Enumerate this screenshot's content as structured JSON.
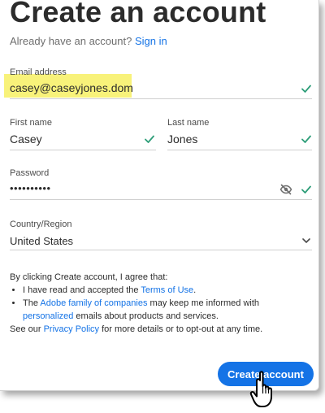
{
  "page": {
    "title": "Create an account",
    "signin_prompt": "Already have an account?",
    "signin_link": "Sign in"
  },
  "form": {
    "email": {
      "label": "Email address",
      "value": "casey@caseyjones.dom"
    },
    "first_name": {
      "label": "First name",
      "value": "Casey"
    },
    "last_name": {
      "label": "Last name",
      "value": "Jones"
    },
    "password": {
      "label": "Password",
      "value": "••••••••••"
    },
    "country": {
      "label": "Country/Region",
      "value": "United States"
    }
  },
  "terms": {
    "intro": "By clicking Create account, I agree that:",
    "bullet1_pre": "I have read and accepted the ",
    "bullet1_link": "Terms of Use",
    "bullet1_post": ".",
    "bullet2_pre": "The ",
    "bullet2_link1": "Adobe family of companies",
    "bullet2_mid": " may keep me informed with ",
    "bullet2_link2": "personalized",
    "bullet2_post": " emails about products and services.",
    "footer_pre": "See our ",
    "footer_link": "Privacy Policy",
    "footer_post": " for more details or to opt-out at any time."
  },
  "actions": {
    "create_label": "Create account"
  },
  "colors": {
    "accent": "#1473e6",
    "check": "#2d9d78",
    "highlight": "#f8f27a"
  },
  "icons": {
    "valid": "check-icon",
    "reveal": "eye-slash-icon",
    "dropdown": "chevron-down-icon",
    "cursor": "hand-pointer-icon"
  }
}
